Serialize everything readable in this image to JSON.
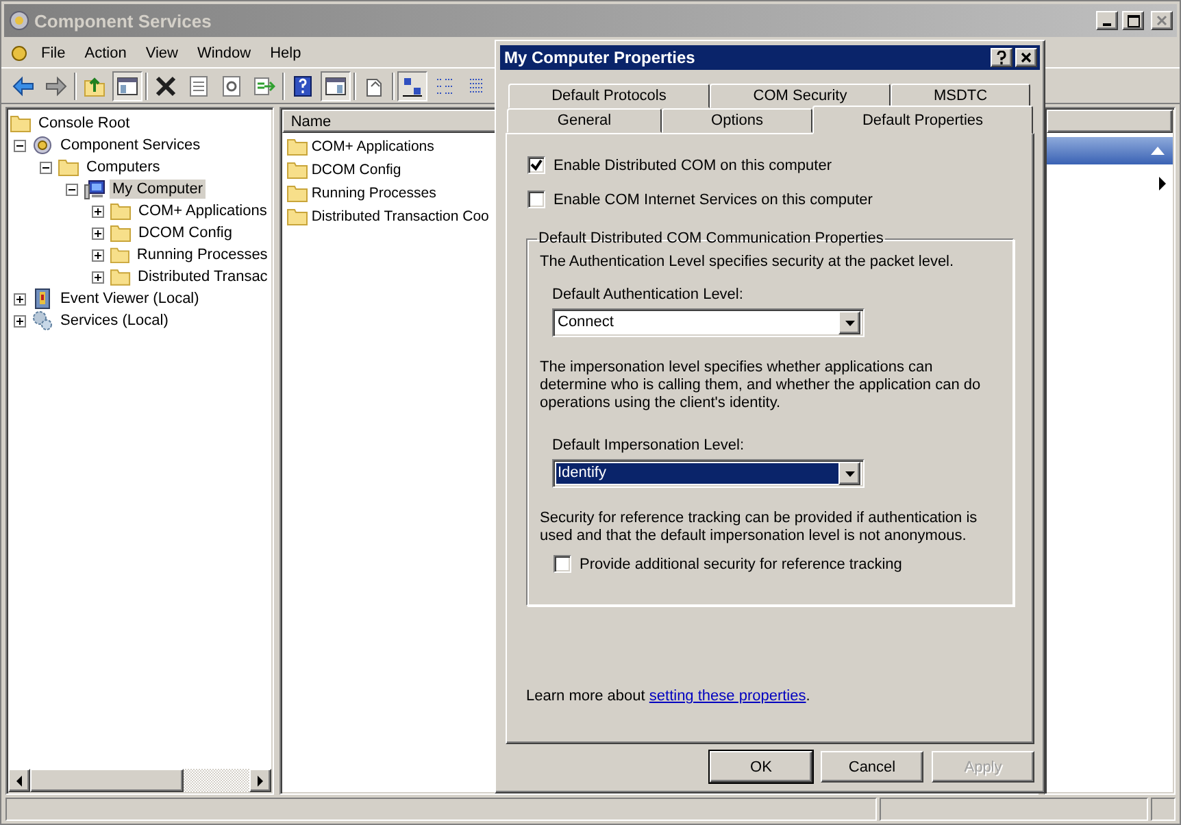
{
  "window": {
    "title": "Component Services"
  },
  "menu": [
    "File",
    "Action",
    "View",
    "Window",
    "Help"
  ],
  "toolbar": [
    {
      "kind": "back",
      "pressed": false
    },
    {
      "kind": "forward",
      "pressed": false
    },
    {
      "kind": "separator"
    },
    {
      "kind": "up",
      "pressed": false
    },
    {
      "kind": "tree",
      "pressed": true
    },
    {
      "kind": "separator"
    },
    {
      "kind": "delete",
      "pressed": false
    },
    {
      "kind": "properties",
      "pressed": false
    },
    {
      "kind": "refresh",
      "pressed": false
    },
    {
      "kind": "export",
      "pressed": false
    },
    {
      "kind": "separator"
    },
    {
      "kind": "help",
      "pressed": false
    },
    {
      "kind": "actionpane",
      "pressed": true
    },
    {
      "kind": "separator"
    },
    {
      "kind": "newwindow",
      "pressed": false
    },
    {
      "kind": "separator"
    },
    {
      "kind": "largeicons",
      "pressed": true
    },
    {
      "kind": "smallicons",
      "pressed": false
    },
    {
      "kind": "list",
      "pressed": false
    }
  ],
  "tree": {
    "label": "Console Root",
    "kind": "folder",
    "selected": false,
    "children": [
      {
        "label": "Component Services",
        "kind": "component",
        "expanded": true,
        "selected": false,
        "children": [
          {
            "label": "Computers",
            "kind": "folder",
            "expanded": true,
            "selected": false,
            "children": [
              {
                "label": "My Computer",
                "kind": "computer",
                "expanded": true,
                "selected": true,
                "children": [
                  {
                    "label": "COM+ Applications",
                    "kind": "folder",
                    "expanded": false,
                    "selected": false
                  },
                  {
                    "label": "DCOM Config",
                    "kind": "folder",
                    "expanded": false,
                    "selected": false
                  },
                  {
                    "label": "Running Processes",
                    "kind": "folder",
                    "expanded": false,
                    "selected": false
                  },
                  {
                    "label": "Distributed Transac",
                    "kind": "folder",
                    "expanded": false,
                    "selected": false
                  }
                ]
              }
            ]
          }
        ]
      },
      {
        "label": "Event Viewer (Local)",
        "kind": "eventviewer",
        "expanded": false,
        "selected": false
      },
      {
        "label": "Services (Local)",
        "kind": "services",
        "expanded": false,
        "selected": false
      }
    ]
  },
  "list": {
    "columns": [
      "Name"
    ],
    "items": [
      "COM+ Applications",
      "DCOM Config",
      "Running Processes",
      "Distributed Transaction Coo"
    ]
  },
  "dialog": {
    "title": "My Computer Properties",
    "tab_rows": [
      [
        {
          "label": "Default Protocols",
          "selected": false
        },
        {
          "label": "COM Security",
          "selected": false
        },
        {
          "label": "MSDTC",
          "selected": false
        }
      ],
      [
        {
          "label": "General",
          "selected": false
        },
        {
          "label": "Options",
          "selected": false
        },
        {
          "label": "Default Properties",
          "selected": true
        }
      ]
    ],
    "checkboxes": [
      {
        "label": "Enable Distributed COM on this computer",
        "checked": true
      },
      {
        "label": "Enable COM Internet Services on this computer",
        "checked": false
      }
    ],
    "group": {
      "title": "Default Distributed COM Communication Properties",
      "auth_text": "The Authentication Level specifies security at the packet level.",
      "auth_label": "Default Authentication Level:",
      "auth_value": "Connect",
      "auth_focused": false,
      "imp_text": "The impersonation level specifies whether applications can determine who is calling them, and whether the application can do operations using the client's identity.",
      "imp_label": "Default Impersonation Level:",
      "imp_value": "Identify",
      "imp_focused": true,
      "ref_text": "Security for reference tracking can be provided if authentication is used and that the default impersonation level is not anonymous.",
      "ref_checkbox": {
        "label": "Provide additional security for reference tracking",
        "checked": false
      }
    },
    "learn_more": {
      "prefix": "Learn more about ",
      "link": "setting these properties",
      "suffix": "."
    },
    "buttons": [
      {
        "label": "OK",
        "default": true,
        "disabled": false
      },
      {
        "label": "Cancel",
        "default": false,
        "disabled": false
      },
      {
        "label": "Apply",
        "default": false,
        "disabled": true
      }
    ]
  }
}
